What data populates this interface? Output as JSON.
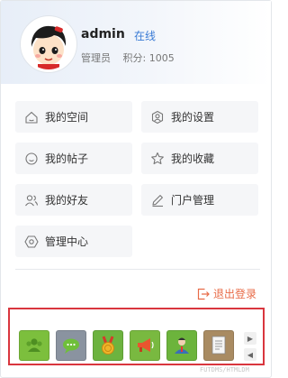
{
  "profile": {
    "username": "admin",
    "status": "在线",
    "role": "管理员",
    "points_label": "积分: 1005"
  },
  "menu": [
    {
      "label": "我的空间",
      "icon": "home-icon"
    },
    {
      "label": "我的设置",
      "icon": "user-settings-icon"
    },
    {
      "label": "我的帖子",
      "icon": "chat-bubble-icon"
    },
    {
      "label": "我的收藏",
      "icon": "star-icon"
    },
    {
      "label": "我的好友",
      "icon": "friends-icon"
    },
    {
      "label": "门户管理",
      "icon": "pencil-icon"
    },
    {
      "label": "管理中心",
      "icon": "hexagon-gear-icon"
    }
  ],
  "logout_label": "退出登录",
  "apps": [
    {
      "name": "people-app-icon",
      "color": "#7cbf3d"
    },
    {
      "name": "chat-app-icon",
      "color": "#8a93a0"
    },
    {
      "name": "medal-app-icon",
      "color": "#6db33f"
    },
    {
      "name": "megaphone-app-icon",
      "color": "#79b940"
    },
    {
      "name": "users-app-icon",
      "color": "#6cb43c"
    },
    {
      "name": "document-app-icon",
      "color": "#a98b62"
    }
  ],
  "colors": {
    "accent": "#3a7bd5",
    "logout": "#e86b47",
    "highlight_border": "#d9363e"
  },
  "watermark": "FUTDMS/HTMLDM"
}
